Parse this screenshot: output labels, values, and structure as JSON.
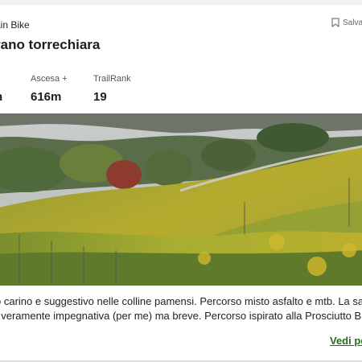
{
  "trail": {
    "category": "ain Bike",
    "save_label": "Salva",
    "title": "rano torrechiara",
    "stats": [
      {
        "label": "",
        "value": "n"
      },
      {
        "label": "Ascesa +",
        "value": "616m"
      },
      {
        "label": "TrailRank",
        "value": "19"
      }
    ],
    "description_lines": [
      "o carino e suggestivo nelle colline pamensi. Percorso misto asfalto e mtb. La salita a",
      ", veramente impegnativa (per me) ma breve. Percorso ispirato alla Prosciutto Bike (Co"
    ],
    "more_label": "Vedi pe"
  },
  "icons": {
    "save": "bookmark-icon"
  },
  "photo": {
    "subject": "vineyard-hillside"
  }
}
